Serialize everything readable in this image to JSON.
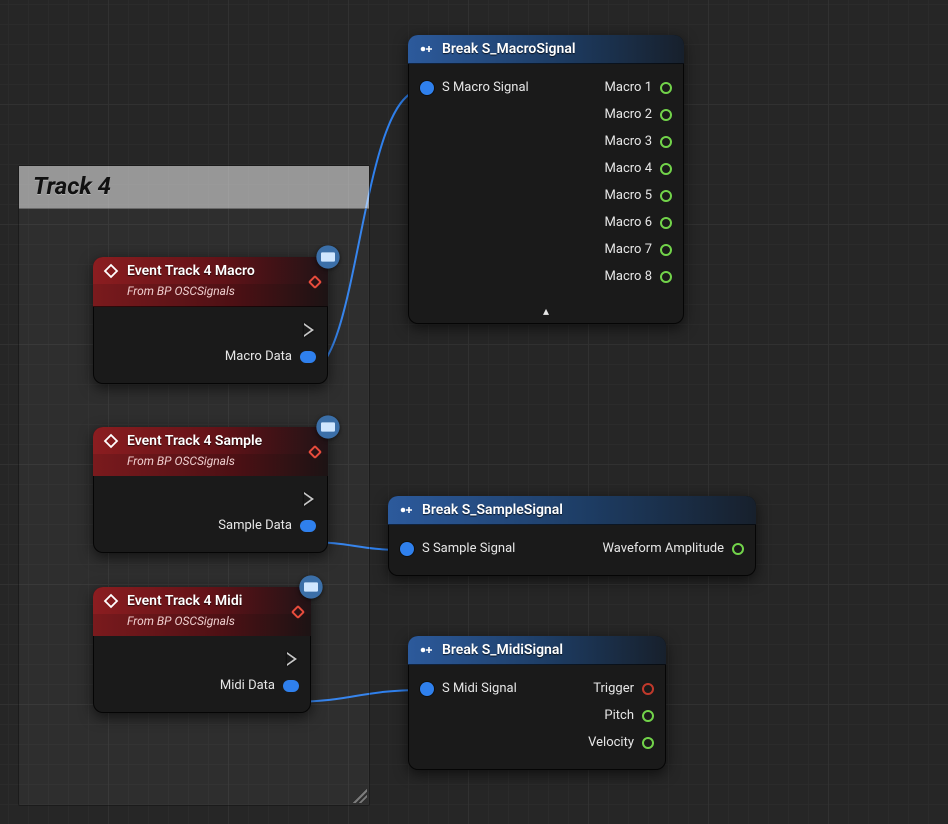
{
  "comment": {
    "title": "Track 4"
  },
  "eventMacro": {
    "title": "Event Track 4 Macro",
    "subtitle": "From BP OSCSignals",
    "out_exec": "",
    "out_data": "Macro Data"
  },
  "eventSample": {
    "title": "Event Track 4 Sample",
    "subtitle": "From BP OSCSignals",
    "out_exec": "",
    "out_data": "Sample Data"
  },
  "eventMidi": {
    "title": "Event Track 4 Midi",
    "subtitle": "From BP OSCSignals",
    "out_exec": "",
    "out_data": "Midi Data"
  },
  "breakMacro": {
    "title": "Break S_MacroSignal",
    "in": "S Macro Signal",
    "outs": [
      "Macro 1",
      "Macro 2",
      "Macro 3",
      "Macro 4",
      "Macro 5",
      "Macro 6",
      "Macro 7",
      "Macro 8"
    ]
  },
  "breakSample": {
    "title": "Break S_SampleSignal",
    "in": "S Sample Signal",
    "outs": [
      "Waveform Amplitude"
    ]
  },
  "breakMidi": {
    "title": "Break S_MidiSignal",
    "in": "S Midi Signal",
    "outs": [
      "Trigger",
      "Pitch",
      "Velocity"
    ]
  }
}
